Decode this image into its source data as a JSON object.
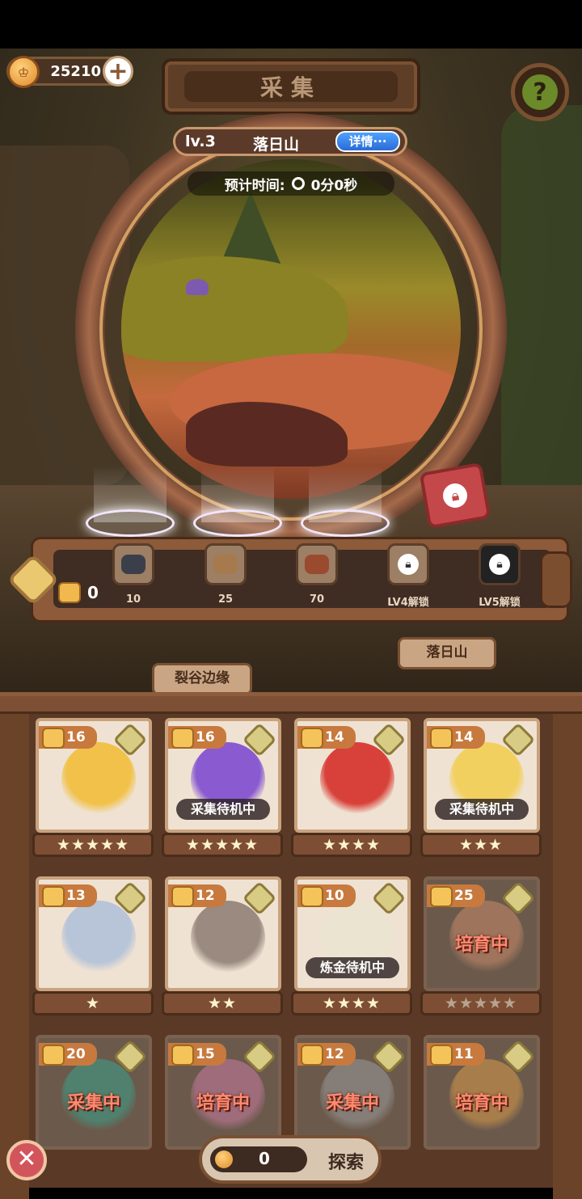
{
  "header": {
    "currency_amount": "25210",
    "plus_label": "+",
    "title": "采集",
    "help_label": "?"
  },
  "location": {
    "level": "lv.3",
    "name": "落日山",
    "detail_label": "详情···",
    "eta_label": "预计时间:",
    "eta_value": "0分0秒"
  },
  "resources": {
    "count": "0",
    "items": [
      {
        "label": "10",
        "icon": "coal-ore-icon",
        "color": "#3b3f4a"
      },
      {
        "label": "25",
        "icon": "dirt-ore-icon",
        "color": "#a77a4e"
      },
      {
        "label": "70",
        "icon": "copper-ore-icon",
        "color": "#9a4a2e"
      },
      {
        "label": "LV4解锁",
        "icon": "lock-icon",
        "color": "#777"
      },
      {
        "label": "LV5解锁",
        "icon": "lock-icon",
        "color": "#222"
      }
    ]
  },
  "map_signs": {
    "left": "裂谷边缘",
    "right": "落日山"
  },
  "roster": [
    {
      "level": "16",
      "status": "",
      "status_style": "",
      "stars": "★★★★★",
      "color": "#f2c14a",
      "dim": false
    },
    {
      "level": "16",
      "status": "采集待机中",
      "status_style": "pill",
      "stars": "★★★★★",
      "color": "#8a5ad0",
      "dim": false
    },
    {
      "level": "14",
      "status": "",
      "status_style": "",
      "stars": "★★★★",
      "color": "#d8413a",
      "dim": false
    },
    {
      "level": "14",
      "status": "采集待机中",
      "status_style": "pill",
      "stars": "★★★",
      "color": "#f2d060",
      "dim": false
    },
    {
      "level": "13",
      "status": "",
      "status_style": "",
      "stars": "★",
      "color": "#b8c4d8",
      "dim": false
    },
    {
      "level": "12",
      "status": "",
      "status_style": "",
      "stars": "★★",
      "color": "#9a8a80",
      "dim": false
    },
    {
      "level": "10",
      "status": "炼金待机中",
      "status_style": "pill",
      "stars": "★★★★",
      "color": "#eae4d0",
      "dim": false
    },
    {
      "level": "25",
      "status": "培育中",
      "status_style": "big",
      "stars": "★★★★★",
      "color": "#c88a6a",
      "dim": true
    },
    {
      "level": "20",
      "status": "采集中",
      "status_style": "big",
      "stars": "",
      "color": "#3aa08a",
      "dim": true
    },
    {
      "level": "15",
      "status": "培育中",
      "status_style": "big",
      "stars": "",
      "color": "#c87aa0",
      "dim": true
    },
    {
      "level": "12",
      "status": "采集中",
      "status_style": "big",
      "stars": "",
      "color": "#9a9a9a",
      "dim": true
    },
    {
      "level": "11",
      "status": "培育中",
      "status_style": "big",
      "stars": "",
      "color": "#d89a4a",
      "dim": true
    }
  ],
  "footer": {
    "close_label": "✕",
    "explore_count": "0",
    "explore_label": "探索"
  }
}
